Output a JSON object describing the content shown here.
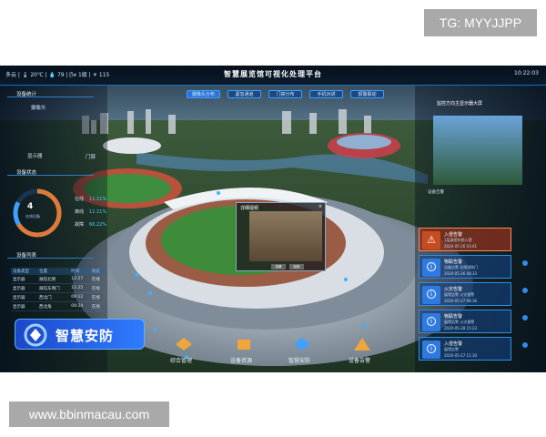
{
  "watermark": {
    "top": "TG: MYYJJPP",
    "bottom": "www.bbinmacau.com"
  },
  "header": {
    "status": "多云 | 🌡 20℃ | 💧 79 | 🌬 1级 | ☀ 115",
    "title": "智慧展览馆可视化处理平台",
    "clock": "10:22:03"
  },
  "nav": {
    "tabs": [
      "摄像头分布",
      "紧急通道",
      "门禁分布",
      "手机对讲",
      "报警联动"
    ]
  },
  "left": {
    "stats_title": "设备统计",
    "camera_label": "摄像头",
    "display_label": "显示器",
    "door_label": "门禁",
    "status_title": "设备状态",
    "ring_value": "4",
    "ring_caption": "在线设备",
    "legend": [
      {
        "name": "在线",
        "value": "11.11%"
      },
      {
        "name": "离线",
        "value": "11.11%"
      },
      {
        "name": "故障",
        "value": "66.22%"
      }
    ],
    "list_title": "设备列表",
    "table": {
      "headers": [
        "设备类型",
        "位置",
        "时间",
        "状态"
      ],
      "rows": [
        [
          "显示器",
          "展馆北侧",
          "12:27",
          "在线"
        ],
        [
          "显示器",
          "展馆东侧门",
          "11:25",
          "在线"
        ],
        [
          "显示器",
          "西北门",
          "09:12",
          "在线"
        ],
        [
          "显示器",
          "西北角",
          "09:24",
          "在线"
        ]
      ]
    },
    "banner": "智慧安防"
  },
  "center": {
    "popup": {
      "title": "详细视频",
      "close": "×",
      "btn1": "查看",
      "btn2": "回放"
    }
  },
  "right": {
    "stats_title": "设备告警",
    "preview_title": "监控方向主显示器大屏",
    "alerts": [
      {
        "title": "入侵告警",
        "sub": "1层展馆东侧入侵",
        "date": "2020-05-26 03:01",
        "level": "red"
      },
      {
        "title": "物联告警",
        "sub": "设备告警 北侧消防门",
        "date": "2020-05-26 08:33",
        "level": "blue"
      },
      {
        "title": "火灾告警",
        "sub": "展馆告警 火灾报警",
        "date": "2020-05-27 08:36",
        "level": "blue"
      },
      {
        "title": "物联告警",
        "sub": "展馆告警 火灾报警",
        "date": "2020-05-28 15:23",
        "level": "blue"
      },
      {
        "title": "入侵告警",
        "sub": "展馆告警",
        "date": "2020-05-27 11:30",
        "level": "blue"
      }
    ]
  },
  "bottom_nav": [
    "综合管理",
    "设备资源",
    "智慧安防",
    "设备告警"
  ],
  "colors": {
    "accent": "#2f7bff",
    "alert": "#c84c22",
    "panel": "#0b1a2a"
  }
}
